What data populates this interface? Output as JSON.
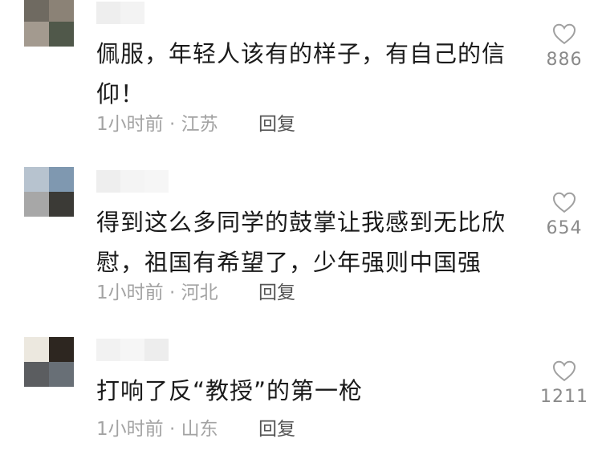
{
  "comments": [
    {
      "text": "佩服，年轻人该有的样子，有自己的信仰！",
      "time": "1小时前",
      "location": "江苏",
      "reply_label": "回复",
      "likes": "886",
      "avatar_colors": [
        "#6f6a61",
        "#8b8276",
        "#a39a8f",
        "#50584a"
      ]
    },
    {
      "text": "得到这么多同学的鼓掌让我感到无比欣慰，祖国有希望了，少年强则中国强",
      "time": "1小时前",
      "location": "河北",
      "reply_label": "回复",
      "likes": "654",
      "avatar_colors": [
        "#b7c3cf",
        "#7f98b0",
        "#a7a7a7",
        "#3b3a36"
      ]
    },
    {
      "text": "打响了反“教授”的第一枪",
      "time": "1小时前",
      "location": "山东",
      "reply_label": "回复",
      "likes": "1211",
      "avatar_colors": [
        "#ece8df",
        "#2d2620",
        "#5b5d60",
        "#686f76"
      ]
    }
  ],
  "separator": "·",
  "icons": {
    "like": "heart-outline-icon"
  },
  "colors": {
    "meta_text": "#a3a3a3",
    "reply_text": "#555555",
    "like_icon": "#a0a0a0",
    "count_text": "#8a8a8a"
  }
}
